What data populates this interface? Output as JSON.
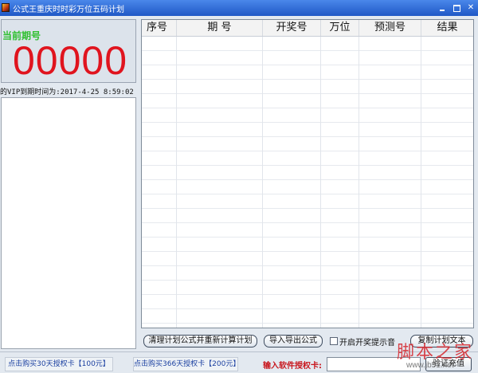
{
  "window": {
    "title": "公式王重庆时时彩万位五码计划",
    "controls": [
      "minimize-icon",
      "maximize-icon",
      "close-icon"
    ],
    "close_glyph": "✕"
  },
  "current_issue": {
    "label": "当前期号",
    "value": "00000",
    "label_color": "#2fbf2f",
    "value_color": "#e0141e"
  },
  "vip": {
    "text": "的VIP到期时间为:2017-4-25 8:59:02"
  },
  "table": {
    "columns": [
      "序号",
      "期 号",
      "开奖号",
      "万位",
      "预测号",
      "结果"
    ],
    "rows": []
  },
  "actions": {
    "recalc_label": "清理计划公式并重新计算计划",
    "import_export_label": "导入导出公式",
    "sound_label": "开启开奖提示音",
    "sound_checked": false,
    "copy_label": "复制计划文本"
  },
  "footer": {
    "buy30_label": "点击购买30天授权卡【100元】",
    "buy366_label": "点击购买366天授权卡【200元】",
    "auth_label": "输入软件授权卡:",
    "auth_value": "",
    "verify_label": "验证充值",
    "link_color": "#1a3fa0",
    "auth_label_color": "#c8161d"
  },
  "watermark": {
    "text": "脚本之家",
    "url": "www.jb51.net"
  }
}
